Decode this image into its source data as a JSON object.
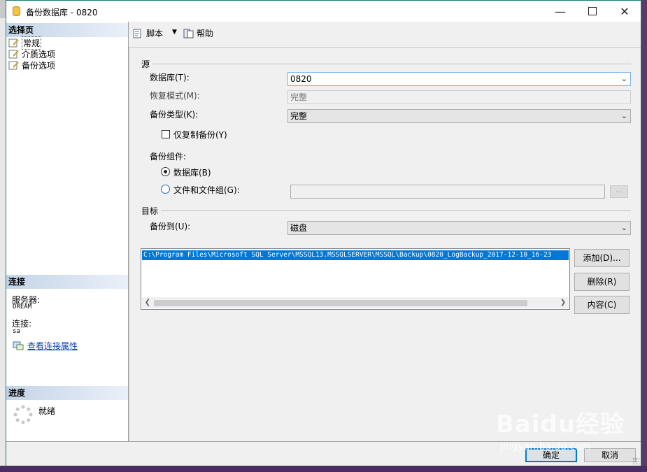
{
  "window": {
    "title": "备份数据库 - 0820"
  },
  "left": {
    "select_page_header": "选择页",
    "pages": [
      "常规",
      "介质选项",
      "备份选项"
    ],
    "connection_header": "连接",
    "server_label": "服务器:",
    "server_value": "DREAM",
    "connection_label": "连接:",
    "connection_value": "sa",
    "view_props_link": "查看连接属性",
    "progress_header": "进度",
    "progress_status": "就绪"
  },
  "toolbar": {
    "script_label": "脚本",
    "help_label": "帮助"
  },
  "source": {
    "group_title": "源",
    "database_label": "数据库(T):",
    "database_value": "0820",
    "recovery_label": "恢复模式(M):",
    "recovery_value": "完整",
    "backup_type_label": "备份类型(K):",
    "backup_type_value": "完整",
    "copy_only_label": "仅复制备份(Y)",
    "component_label": "备份组件:",
    "radio_db_label": "数据库(B)",
    "radio_files_label": "文件和文件组(G):",
    "files_value": "",
    "ellipsis": "..."
  },
  "target": {
    "group_title": "目标",
    "backup_to_label": "备份到(U):",
    "backup_to_value": "磁盘",
    "paths": [
      "C:\\Program Files\\Microsoft SQL Server\\MSSQL13.MSSQLSERVER\\MSSQL\\Backup\\0820_LogBackup_2017-12-10_16-23"
    ],
    "add_button": "添加(D)...",
    "remove_button": "删除(R)",
    "contents_button": "内容(C)"
  },
  "footer": {
    "ok_button": "确定",
    "cancel_button": "取消"
  },
  "watermark": {
    "text": "Baidu经验",
    "sub": "jingyan.baidu.com"
  }
}
